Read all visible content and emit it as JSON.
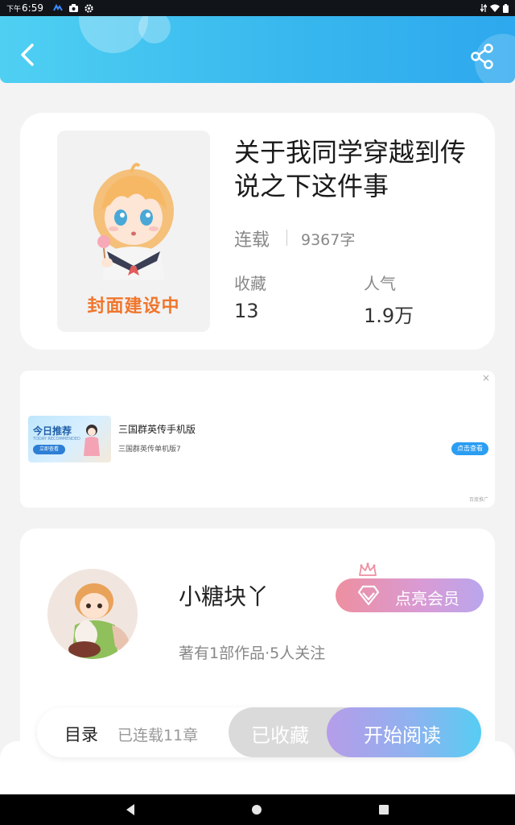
{
  "status_bar": {
    "time_prefix": "下午",
    "time": "6:59"
  },
  "header": {
    "back_icon": "chevron-left-icon",
    "share_icon": "share-icon"
  },
  "book": {
    "title": "关于我同学穿越到传说之下这件事",
    "cover_text": "封面建设中",
    "status": "连载",
    "word_count": "9367字",
    "stats": [
      {
        "label": "收藏",
        "value": "13"
      },
      {
        "label": "人气",
        "value": "1.9万"
      }
    ]
  },
  "ad": {
    "close": "×",
    "image_title": "今日推荐",
    "image_subtitle": "TODAY RECOMMENDED",
    "image_button": "立即查看",
    "title": "三国群英传手机版",
    "description": "三国群英传单机版7",
    "cta": "点击查看",
    "source": "百度推广"
  },
  "author": {
    "name": "小糖块丫",
    "meta": "著有1部作品·5人关注",
    "vip_button": "点亮会员"
  },
  "action_bar": {
    "toc_label": "目录",
    "toc_count": "已连载11章",
    "collected_label": "已收藏",
    "read_label": "开始阅读"
  },
  "colors": {
    "header_start": "#4fd0f2",
    "header_end": "#2ea8ee",
    "cover_text": "#f0762c",
    "vip_start": "#ee8fa0",
    "vip_end": "#b9a6ec",
    "read_start": "#b69ce9",
    "read_end": "#56cdf3"
  }
}
